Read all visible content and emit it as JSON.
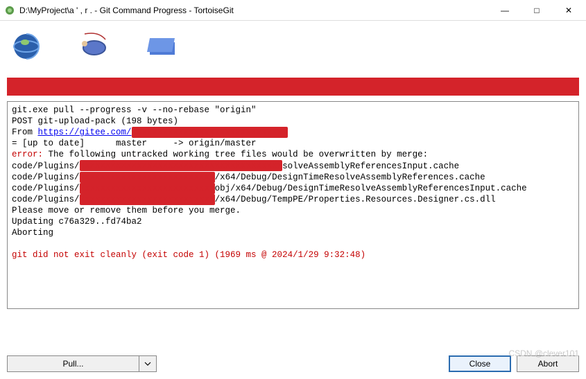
{
  "title": "D:\\MyProject\\a   '    , r . - Git Command Progress - TortoiseGit",
  "toolbar": {
    "globe": "globe-icon",
    "tortoise": "tortoise-icon",
    "folder": "folder-icon"
  },
  "output": {
    "line1": "git.exe pull --progress -v --no-rebase \"origin\"",
    "line2": "POST git-upload-pack (198 bytes)",
    "line3_pre": "From ",
    "line3_url": "https://gitee.com/",
    "line4": "= [up to date]      master     -> origin/master",
    "line5_err": "error:",
    "line5_rest": " The following untracked working tree files would be overwritten by merge:",
    "line6_pre": "code/Plugins/",
    "line6_rest": "solveAssemblyReferencesInput.cache",
    "line7_pre": "code/Plugins/",
    "line7_rest": "/x64/Debug/DesignTimeResolveAssemblyReferences.cache",
    "line8_pre": "code/Plugins/",
    "line8_rest": "obj/x64/Debug/DesignTimeResolveAssemblyReferencesInput.cache",
    "line9_pre": "code/Plugins/",
    "line9_rest": "/x64/Debug/TempPE/Properties.Resources.Designer.cs.dll",
    "line10": "Please move or remove them before you merge.",
    "line11": "Updating c76a329..fd74ba2",
    "line12": "Aborting",
    "blank": " ",
    "exitline": "git did not exit cleanly (exit code 1) (1969 ms @ 2024/1/29 9:32:48)"
  },
  "buttons": {
    "pull": "Pull...",
    "close": "Close",
    "abort": "Abort"
  },
  "watermark": "CSDN @clever101"
}
